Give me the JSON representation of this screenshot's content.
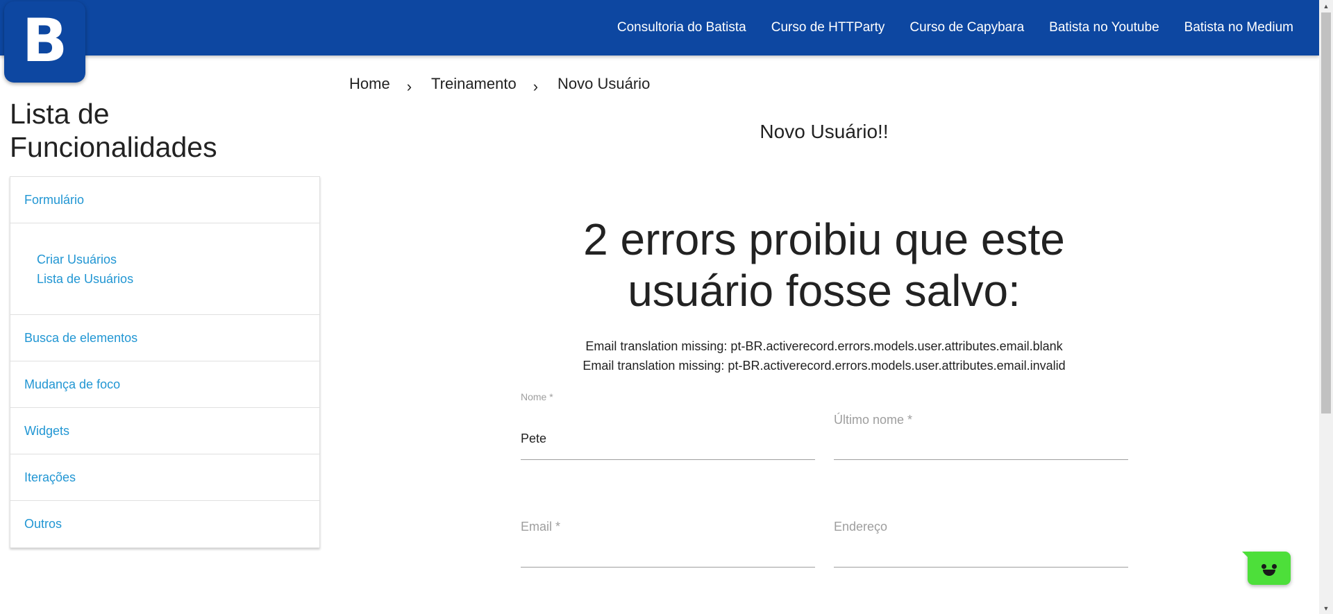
{
  "header": {
    "logo_letter": "B",
    "nav": [
      {
        "label": "Consultoria do Batista"
      },
      {
        "label": "Curso de HTTParty"
      },
      {
        "label": "Curso de Capybara"
      },
      {
        "label": "Batista no Youtube"
      },
      {
        "label": "Batista no Medium"
      }
    ]
  },
  "sidebar": {
    "title": "Lista de Funcionalidades",
    "items": [
      {
        "label": "Formulário"
      },
      {
        "label": "Busca de elementos"
      },
      {
        "label": "Mudança de foco"
      },
      {
        "label": "Widgets"
      },
      {
        "label": "Iterações"
      },
      {
        "label": "Outros"
      }
    ],
    "submenu": [
      {
        "label": "Criar Usuários"
      },
      {
        "label": "Lista de Usuários"
      }
    ]
  },
  "breadcrumb": {
    "items": [
      "Home",
      "Treinamento",
      "Novo Usuário"
    ],
    "separator": "›"
  },
  "main": {
    "title": "Novo Usuário!!",
    "error_heading": "2 errors proibiu que este usuário fosse salvo:",
    "errors": [
      "Email translation missing: pt-BR.activerecord.errors.models.user.attributes.email.blank",
      "Email translation missing: pt-BR.activerecord.errors.models.user.attributes.email.invalid"
    ]
  },
  "form": {
    "nome_label": "Nome *",
    "nome_value": "Pete",
    "ultimo_nome_label": "Último nome *",
    "ultimo_nome_value": "",
    "email_label": "Email *",
    "email_value": "",
    "endereco_label": "Endereço",
    "endereco_value": ""
  },
  "colors": {
    "header_bg": "#0d47a1",
    "link": "#2196d3",
    "chat_widget": "#4ddf3a"
  },
  "icons": {
    "chat": "chat-bot-face-icon",
    "breadcrumb_separator": "chevron-right-icon"
  }
}
